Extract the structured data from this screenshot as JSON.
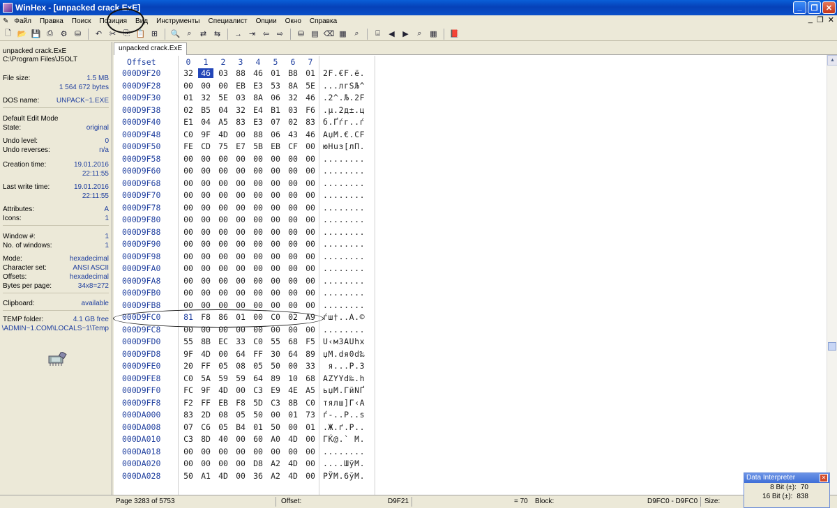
{
  "window": {
    "title": "WinHex - [unpacked crack.ExE]"
  },
  "menu": [
    "Файл",
    "Правка",
    "Поиск",
    "Позиция",
    "Вид",
    "Инструменты",
    "Специалист",
    "Опции",
    "Окно",
    "Справка"
  ],
  "file_info": {
    "name": "unpacked crack.ExE",
    "path": "C:\\Program Files\\J5OLT",
    "file_size_label": "File size:",
    "file_size_mb": "1.5 MB",
    "file_size_bytes": "1 564 672 bytes",
    "dos_name_label": "DOS name:",
    "dos_name": "UNPACK~1.EXE",
    "edit_mode": "Default Edit Mode",
    "state_label": "State:",
    "state": "original",
    "undo_level_label": "Undo level:",
    "undo_level": "0",
    "undo_reverses_label": "Undo reverses:",
    "undo_reverses": "n/a",
    "creation_time_label": "Creation time:",
    "creation_date": "19.01.2016",
    "creation_clock": "22:11:55",
    "last_write_label": "Last write time:",
    "last_write_date": "19.01.2016",
    "last_write_clock": "22:11:55",
    "attributes_label": "Attributes:",
    "attributes": "A",
    "icons_label": "Icons:",
    "icons": "1",
    "window_no_label": "Window #:",
    "window_no": "1",
    "windows_count_label": "No. of windows:",
    "windows_count": "1",
    "mode_label": "Mode:",
    "mode": "hexadecimal",
    "charset_label": "Character set:",
    "charset": "ANSI ASCII",
    "offsets_label": "Offsets:",
    "offsets": "hexadecimal",
    "bpp_label": "Bytes per page:",
    "bpp": "34x8=272",
    "clipboard_label": "Clipboard:",
    "clipboard": "available",
    "temp_label": "TEMP folder:",
    "temp_free": "4.1 GB free",
    "temp_path": "\\ADMIN~1.COM\\LOCALS~1\\Temp"
  },
  "tab": {
    "label": "unpacked crack.ExE"
  },
  "hex_header": {
    "offset": "Offset",
    "cols": [
      "0",
      "1",
      "2",
      "3",
      "4",
      "5",
      "6",
      "7"
    ]
  },
  "rows": [
    {
      "offset": "000D9F20",
      "bytes": [
        "32",
        "46",
        "03",
        "88",
        "46",
        "01",
        "B8",
        "01"
      ],
      "text": "2F.€F.ё."
    },
    {
      "offset": "000D9F28",
      "bytes": [
        "00",
        "00",
        "00",
        "EB",
        "E3",
        "53",
        "8A",
        "5E"
      ],
      "text": "...лгSЉ^"
    },
    {
      "offset": "000D9F30",
      "bytes": [
        "01",
        "32",
        "5E",
        "03",
        "8A",
        "06",
        "32",
        "46"
      ],
      "text": ".2^.Љ.2F"
    },
    {
      "offset": "000D9F38",
      "bytes": [
        "02",
        "B5",
        "04",
        "32",
        "E4",
        "B1",
        "03",
        "F6"
      ],
      "text": ".µ.2д±.ц"
    },
    {
      "offset": "000D9F40",
      "bytes": [
        "E1",
        "04",
        "A5",
        "83",
        "E3",
        "07",
        "02",
        "83"
      ],
      "text": "б.Ґѓг..ѓ"
    },
    {
      "offset": "000D9F48",
      "bytes": [
        "C0",
        "9F",
        "4D",
        "00",
        "88",
        "06",
        "43",
        "46"
      ],
      "text": "АџM.€.CF"
    },
    {
      "offset": "000D9F50",
      "bytes": [
        "FE",
        "CD",
        "75",
        "E7",
        "5B",
        "EB",
        "CF",
        "00"
      ],
      "text": "юНuз[лП."
    },
    {
      "offset": "000D9F58",
      "bytes": [
        "00",
        "00",
        "00",
        "00",
        "00",
        "00",
        "00",
        "00"
      ],
      "text": "........"
    },
    {
      "offset": "000D9F60",
      "bytes": [
        "00",
        "00",
        "00",
        "00",
        "00",
        "00",
        "00",
        "00"
      ],
      "text": "........"
    },
    {
      "offset": "000D9F68",
      "bytes": [
        "00",
        "00",
        "00",
        "00",
        "00",
        "00",
        "00",
        "00"
      ],
      "text": "........"
    },
    {
      "offset": "000D9F70",
      "bytes": [
        "00",
        "00",
        "00",
        "00",
        "00",
        "00",
        "00",
        "00"
      ],
      "text": "........"
    },
    {
      "offset": "000D9F78",
      "bytes": [
        "00",
        "00",
        "00",
        "00",
        "00",
        "00",
        "00",
        "00"
      ],
      "text": "........"
    },
    {
      "offset": "000D9F80",
      "bytes": [
        "00",
        "00",
        "00",
        "00",
        "00",
        "00",
        "00",
        "00"
      ],
      "text": "........"
    },
    {
      "offset": "000D9F88",
      "bytes": [
        "00",
        "00",
        "00",
        "00",
        "00",
        "00",
        "00",
        "00"
      ],
      "text": "........"
    },
    {
      "offset": "000D9F90",
      "bytes": [
        "00",
        "00",
        "00",
        "00",
        "00",
        "00",
        "00",
        "00"
      ],
      "text": "........"
    },
    {
      "offset": "000D9F98",
      "bytes": [
        "00",
        "00",
        "00",
        "00",
        "00",
        "00",
        "00",
        "00"
      ],
      "text": "........"
    },
    {
      "offset": "000D9FA0",
      "bytes": [
        "00",
        "00",
        "00",
        "00",
        "00",
        "00",
        "00",
        "00"
      ],
      "text": "........"
    },
    {
      "offset": "000D9FA8",
      "bytes": [
        "00",
        "00",
        "00",
        "00",
        "00",
        "00",
        "00",
        "00"
      ],
      "text": "........"
    },
    {
      "offset": "000D9FB0",
      "bytes": [
        "00",
        "00",
        "00",
        "00",
        "00",
        "00",
        "00",
        "00"
      ],
      "text": "........"
    },
    {
      "offset": "000D9FB8",
      "bytes": [
        "00",
        "00",
        "00",
        "00",
        "00",
        "00",
        "00",
        "00"
      ],
      "text": "........"
    },
    {
      "offset": "000D9FC0",
      "bytes": [
        "81",
        "F8",
        "86",
        "01",
        "00",
        "C0",
        "02",
        "A9"
      ],
      "text": "ѓш†..А.©"
    },
    {
      "offset": "000D9FC8",
      "bytes": [
        "00",
        "00",
        "00",
        "00",
        "00",
        "00",
        "00",
        "00"
      ],
      "text": "........"
    },
    {
      "offset": "000D9FD0",
      "bytes": [
        "55",
        "8B",
        "EC",
        "33",
        "C0",
        "55",
        "68",
        "F5"
      ],
      "text": "U‹м3АUhх"
    },
    {
      "offset": "000D9FD8",
      "bytes": [
        "9F",
        "4D",
        "00",
        "64",
        "FF",
        "30",
        "64",
        "89"
      ],
      "text": "џM.dя0d‰"
    },
    {
      "offset": "000D9FE0",
      "bytes": [
        "20",
        "FF",
        "05",
        "08",
        "05",
        "50",
        "00",
        "33"
      ],
      "text": " я...P.3"
    },
    {
      "offset": "000D9FE8",
      "bytes": [
        "C0",
        "5A",
        "59",
        "59",
        "64",
        "89",
        "10",
        "68"
      ],
      "text": "АZYYd‰.h"
    },
    {
      "offset": "000D9FF0",
      "bytes": [
        "FC",
        "9F",
        "4D",
        "00",
        "C3",
        "E9",
        "4E",
        "A5"
      ],
      "text": "ьџM.ГйNҐ"
    },
    {
      "offset": "000D9FF8",
      "bytes": [
        "F2",
        "FF",
        "EB",
        "F8",
        "5D",
        "C3",
        "8B",
        "C0"
      ],
      "text": "тялш]Г‹А"
    },
    {
      "offset": "000DA000",
      "bytes": [
        "83",
        "2D",
        "08",
        "05",
        "50",
        "00",
        "01",
        "73"
      ],
      "text": "ѓ-..P..s"
    },
    {
      "offset": "000DA008",
      "bytes": [
        "07",
        "C6",
        "05",
        "B4",
        "01",
        "50",
        "00",
        "01"
      ],
      "text": ".Ж.ґ.P.."
    },
    {
      "offset": "000DA010",
      "bytes": [
        "C3",
        "8D",
        "40",
        "00",
        "60",
        "A0",
        "4D",
        "00"
      ],
      "text": "ГЌ@.` M."
    },
    {
      "offset": "000DA018",
      "bytes": [
        "00",
        "00",
        "00",
        "00",
        "00",
        "00",
        "00",
        "00"
      ],
      "text": "........"
    },
    {
      "offset": "000DA020",
      "bytes": [
        "00",
        "00",
        "00",
        "00",
        "D8",
        "A2",
        "4D",
        "00"
      ],
      "text": "....ШўM."
    },
    {
      "offset": "000DA028",
      "bytes": [
        "50",
        "A1",
        "4D",
        "00",
        "36",
        "A2",
        "4D",
        "00"
      ],
      "text": "PЎM.6ўM."
    }
  ],
  "status": {
    "page": "Page 3283 of 5753",
    "offset_label": "Offset:",
    "offset_value": "D9F21",
    "eq_value": "= 70",
    "block_label": "Block:",
    "block_value": "D9FC0 - D9FC0",
    "size_label": "Size:"
  },
  "data_interpreter": {
    "title": "Data Interpreter",
    "rows": [
      {
        "label": "8 Bit (±):",
        "value": "70"
      },
      {
        "label": "16 Bit (±):",
        "value": "838"
      }
    ]
  }
}
